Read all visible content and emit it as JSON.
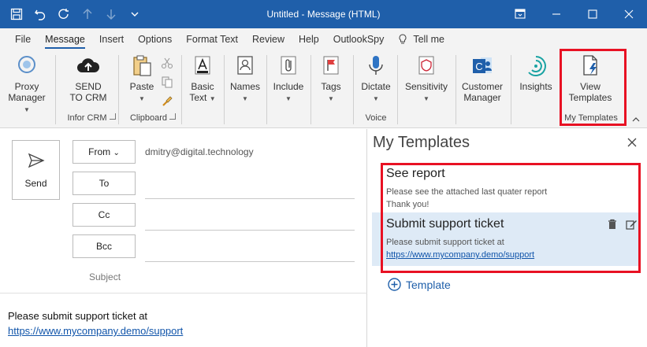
{
  "window": {
    "title": "Untitled  -  Message (HTML)"
  },
  "qat": {
    "icons": [
      "save-icon",
      "undo-icon",
      "redo-icon",
      "previous-item-icon",
      "next-item-icon",
      "customize-qat-icon"
    ]
  },
  "tabs": [
    {
      "label": "File"
    },
    {
      "label": "Message"
    },
    {
      "label": "Insert"
    },
    {
      "label": "Options"
    },
    {
      "label": "Format Text"
    },
    {
      "label": "Review"
    },
    {
      "label": "Help"
    },
    {
      "label": "OutlookSpy"
    }
  ],
  "tell_me": "Tell me",
  "ribbon": {
    "proxy_manager": {
      "line1": "Proxy",
      "line2": "Manager"
    },
    "send_to_crm": {
      "line1": "SEND",
      "line2": "TO CRM"
    },
    "paste": "Paste",
    "basic_text": {
      "line1": "Basic",
      "line2": "Text"
    },
    "names": "Names",
    "include": "Include",
    "tags": "Tags",
    "dictate": "Dictate",
    "sensitivity": "Sensitivity",
    "customer_manager": {
      "line1": "Customer",
      "line2": "Manager"
    },
    "insights": "Insights",
    "view_templates": {
      "line1": "View",
      "line2": "Templates"
    },
    "groups": {
      "infor_crm": "Infor CRM",
      "clipboard": "Clipboard",
      "voice": "Voice",
      "my_templates": "My Templates"
    }
  },
  "compose": {
    "send_label": "Send",
    "from_label": "From",
    "to_label": "To",
    "cc_label": "Cc",
    "bcc_label": "Bcc",
    "from_address": "dmitry@digital.technology",
    "subject_label": "Subject",
    "body_line1": "Please submit support ticket at",
    "body_link": "https://www.mycompany.demo/support"
  },
  "pane": {
    "title": "My Templates",
    "templates": [
      {
        "title": "See report",
        "line1": "Please see the attached last quater report",
        "line2": "Thank you!"
      },
      {
        "title": "Submit support ticket",
        "line1": "Please submit support ticket at",
        "link": "https://www.mycompany.demo/support"
      }
    ],
    "add_label": "Template"
  },
  "colors": {
    "titlebar": "#1f5faa",
    "highlight": "#e81123",
    "selected_template": "#deeaf6",
    "link": "#1155aa"
  }
}
